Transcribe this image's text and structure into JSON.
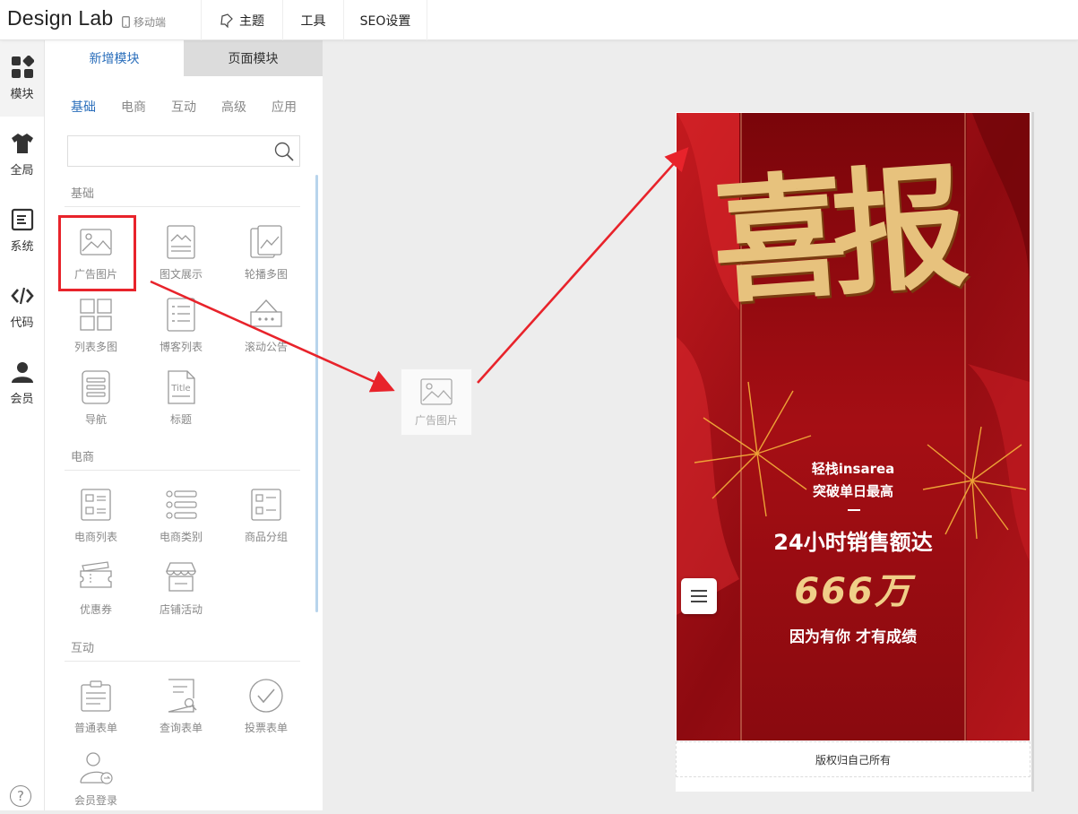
{
  "app": {
    "title": "Design Lab",
    "mode": "移动端"
  },
  "topnav": [
    {
      "label": "主题",
      "icon": "theme-icon"
    },
    {
      "label": "工具"
    },
    {
      "label": "SEO设置"
    }
  ],
  "rail": [
    {
      "label": "模块",
      "icon": "modules-icon"
    },
    {
      "label": "全局",
      "icon": "shirt-icon"
    },
    {
      "label": "系统",
      "icon": "document-icon"
    },
    {
      "label": "代码",
      "icon": "code-icon"
    },
    {
      "label": "会员",
      "icon": "user-icon"
    }
  ],
  "panel": {
    "tabs": [
      "新增模块",
      "页面模块"
    ],
    "categories": [
      "基础",
      "电商",
      "互动",
      "高级",
      "应用"
    ],
    "sections": [
      {
        "title": "基础",
        "items": [
          "广告图片",
          "图文展示",
          "轮播多图",
          "列表多图",
          "博客列表",
          "滚动公告",
          "导航",
          "标题"
        ]
      },
      {
        "title": "电商",
        "items": [
          "电商列表",
          "电商类别",
          "商品分组",
          "优惠券",
          "店铺活动"
        ]
      },
      {
        "title": "互动",
        "items": [
          "普通表单",
          "查询表单",
          "投票表单",
          "会员登录"
        ]
      }
    ]
  },
  "drag": {
    "label": "广告图片"
  },
  "poster": {
    "headline": "喜报",
    "line1": "轻栈insarea",
    "line2": "突破单日最高",
    "line3": "24小时销售额达",
    "amount": "666万",
    "line4": "因为有你 才有成绩"
  },
  "footer": {
    "text": "版权归自己所有"
  },
  "colors": {
    "accent": "#2a6ebb",
    "highlight": "#e8232b",
    "poster_red": "#9d0d13",
    "gold": "#e3c07a"
  }
}
